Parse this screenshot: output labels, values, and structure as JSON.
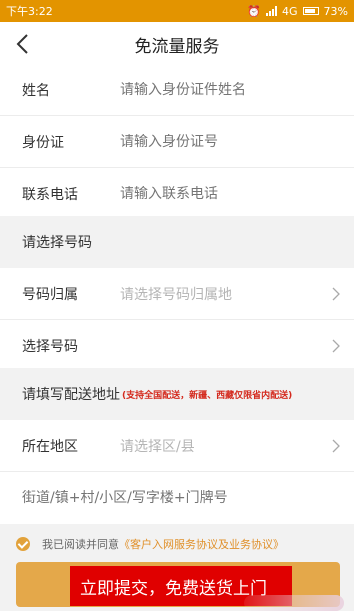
{
  "statusbar": {
    "time": "下午3:22",
    "network": "4G",
    "battery": "73%"
  },
  "nav": {
    "title": "免流量服务"
  },
  "personal": [
    {
      "label": "姓名",
      "placeholder": "请输入身份证件姓名"
    },
    {
      "label": "身份证",
      "placeholder": "请输入身份证号"
    },
    {
      "label": "联系电话",
      "placeholder": "请输入联系电话"
    }
  ],
  "number_section": {
    "title": "请选择号码"
  },
  "number_rows": [
    {
      "label": "号码归属",
      "placeholder": "请选择号码归属地"
    },
    {
      "label": "选择号码",
      "placeholder": ""
    }
  ],
  "address_section": {
    "title": "请填写配送地址",
    "note": "(支持全国配送，新疆、西藏仅限省内配送)"
  },
  "address_rows": [
    {
      "label": "所在地区",
      "placeholder": "请选择区/县"
    }
  ],
  "street": {
    "placeholder": "街道/镇+村/小区/写字楼+门牌号"
  },
  "agreement": {
    "prefix": "我已阅读并同意",
    "link": "《客户入网服务协议及业务协议》"
  },
  "submit": {
    "label": "立即提交，免费送货上门"
  },
  "colors": {
    "statusbar": "#e39400",
    "accent": "#e4a84a",
    "highlight": "#e00000",
    "note": "#d42a1e"
  }
}
